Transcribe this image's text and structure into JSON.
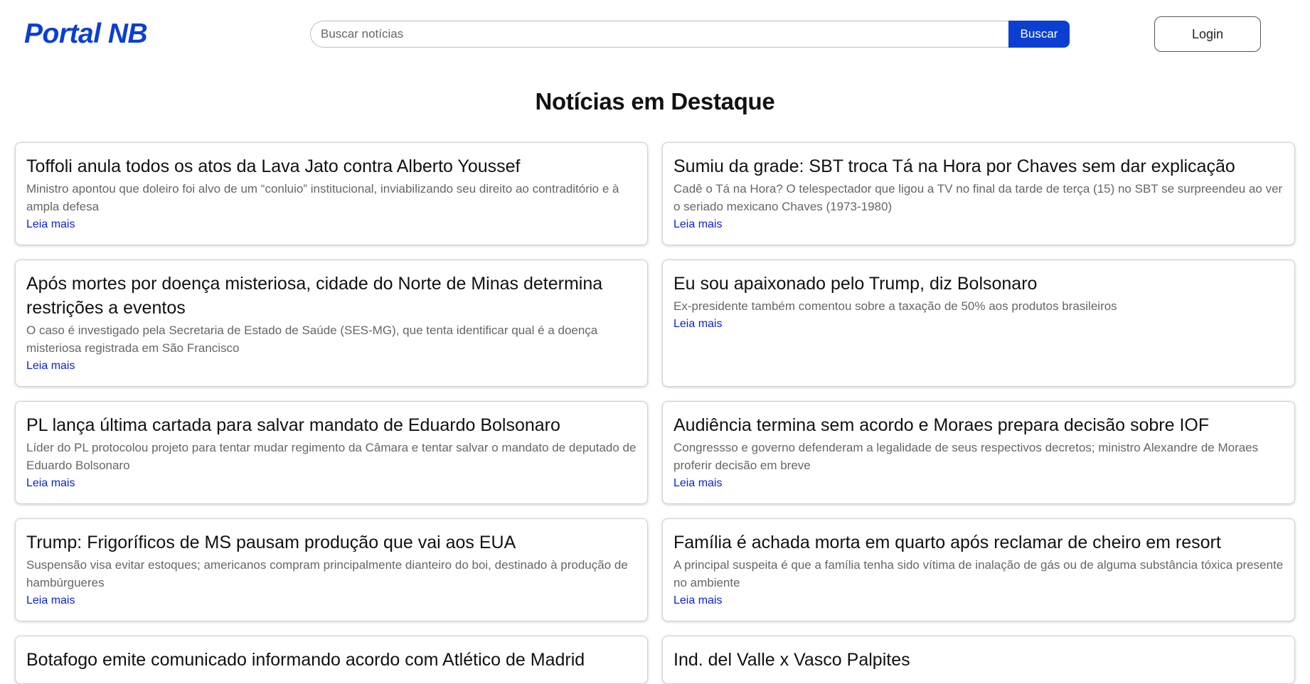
{
  "header": {
    "logo": "Portal NB",
    "search_placeholder": "Buscar notícias",
    "search_button": "Buscar",
    "login_button": "Login"
  },
  "main": {
    "title": "Notícias em Destaque",
    "read_more": "Leia mais",
    "articles": [
      {
        "title": "Toffoli anula todos os atos da Lava Jato contra Alberto Youssef",
        "summary": "Ministro apontou que doleiro foi alvo de um “conluio” institucional, inviabilizando seu direito ao contraditório e à ampla defesa"
      },
      {
        "title": "Sumiu da grade: SBT troca Tá na Hora por Chaves sem dar explicação",
        "summary": "Cadê o Tá na Hora? O telespectador que ligou a TV no final da tarde de terça (15) no SBT se surpreendeu ao ver o seriado mexicano Chaves (1973-1980)"
      },
      {
        "title": "Após mortes por doença misteriosa, cidade do Norte de Minas determina restrições a eventos",
        "summary": "O caso é investigado pela Secretaria de Estado de Saúde (SES-MG), que tenta identificar qual é a doença misteriosa registrada em São Francisco"
      },
      {
        "title": "Eu sou apaixonado pelo Trump, diz Bolsonaro",
        "summary": "Ex-presidente também comentou sobre a taxação de 50% aos produtos brasileiros"
      },
      {
        "title": "PL lança última cartada para salvar mandato de Eduardo Bolsonaro",
        "summary": "Líder do PL protocolou projeto para tentar mudar regimento da Câmara e tentar salvar o mandato de deputado de Eduardo Bolsonaro"
      },
      {
        "title": "Audiência termina sem acordo e Moraes prepara decisão sobre IOF",
        "summary": "Congressso e governo defenderam a legalidade de seus respectivos decretos; ministro Alexandre de Moraes proferir decisão em breve"
      },
      {
        "title": "Trump: Frigoríficos de MS pausam produção que vai aos EUA",
        "summary": "Suspensão visa evitar estoques; americanos compram principalmente dianteiro do boi, destinado à produção de hambúrgueres"
      },
      {
        "title": "Família é achada morta em quarto após reclamar de cheiro em resort",
        "summary": "A principal suspeita é que a família tenha sido vítima de inalação de gás ou de alguma substância tóxica presente no ambiente"
      },
      {
        "title": "Botafogo emite comunicado informando acordo com Atlético de Madrid",
        "summary": ""
      },
      {
        "title": "Ind. del Valle x Vasco Palpites",
        "summary": ""
      }
    ]
  },
  "colors": {
    "brand": "#0b3fd1",
    "link": "#0b1fd1",
    "muted_text": "#666666"
  }
}
